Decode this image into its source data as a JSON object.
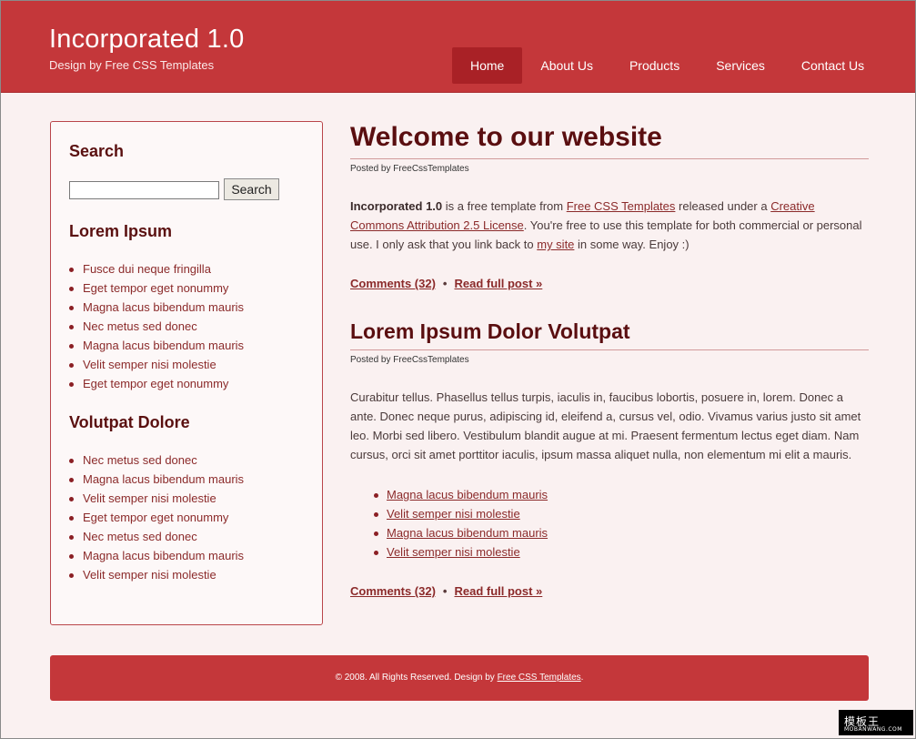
{
  "header": {
    "title": "Incorporated 1.0",
    "subtitle": "Design by Free CSS Templates",
    "menu": [
      "Home",
      "About Us",
      "Products",
      "Services",
      "Contact Us"
    ],
    "current_menu_index": 0
  },
  "sidebar": {
    "search_heading": "Search",
    "search_value": "",
    "search_button": "Search",
    "section1_heading": "Lorem Ipsum",
    "section1_items": [
      "Fusce dui neque fringilla",
      "Eget tempor eget nonummy",
      "Magna lacus bibendum mauris",
      "Nec metus sed donec",
      "Magna lacus bibendum mauris",
      "Velit semper nisi molestie",
      "Eget tempor eget nonummy"
    ],
    "section2_heading": "Volutpat Dolore",
    "section2_items": [
      "Nec metus sed donec",
      "Magna lacus bibendum mauris",
      "Velit semper nisi molestie",
      "Eget tempor eget nonummy",
      "Nec metus sed donec",
      "Magna lacus bibendum mauris",
      "Velit semper nisi molestie"
    ]
  },
  "posts": [
    {
      "title": "Welcome to our website",
      "meta": "Posted by FreeCssTemplates",
      "body_bold": "Incorporated 1.0",
      "body_part1": " is a free template from ",
      "body_link1": "Free CSS Templates",
      "body_part2": " released under a ",
      "body_link2": "Creative Commons Attribution 2.5 License",
      "body_part3": ". You're free to use this template for both commercial or personal use. I only ask that you link back to ",
      "body_link3": "my site",
      "body_part4": " in some way. Enjoy :)",
      "comments": "Comments (32)",
      "separator": "•",
      "read_more": "Read full post »"
    },
    {
      "title": "Lorem Ipsum Dolor Volutpat",
      "meta": "Posted by FreeCssTemplates",
      "body": "Curabitur tellus. Phasellus tellus turpis, iaculis in, faucibus lobortis, posuere in, lorem. Donec a ante. Donec neque purus, adipiscing id, eleifend a, cursus vel, odio. Vivamus varius justo sit amet leo. Morbi sed libero. Vestibulum blandit augue at mi. Praesent fermentum lectus eget diam. Nam cursus, orci sit amet porttitor iaculis, ipsum massa aliquet nulla, non elementum mi elit a mauris.",
      "list": [
        "Magna lacus bibendum mauris",
        "Velit semper nisi molestie",
        "Magna lacus bibendum mauris",
        "Velit semper nisi molestie"
      ],
      "comments": "Comments (32)",
      "separator": "•",
      "read_more": "Read full post »"
    }
  ],
  "footer": {
    "text": "© 2008. All Rights Reserved. Design by ",
    "link": "Free CSS Templates",
    "end": "."
  },
  "watermark": {
    "logo": "模板王",
    "url": "MOBANWANG.COM"
  },
  "colors": {
    "brand_red": "#c4373a",
    "active_menu": "#a92126",
    "heading_dark_red": "#5a0e10",
    "link_red": "#8b2a2a",
    "page_bg": "#faf1f1"
  }
}
